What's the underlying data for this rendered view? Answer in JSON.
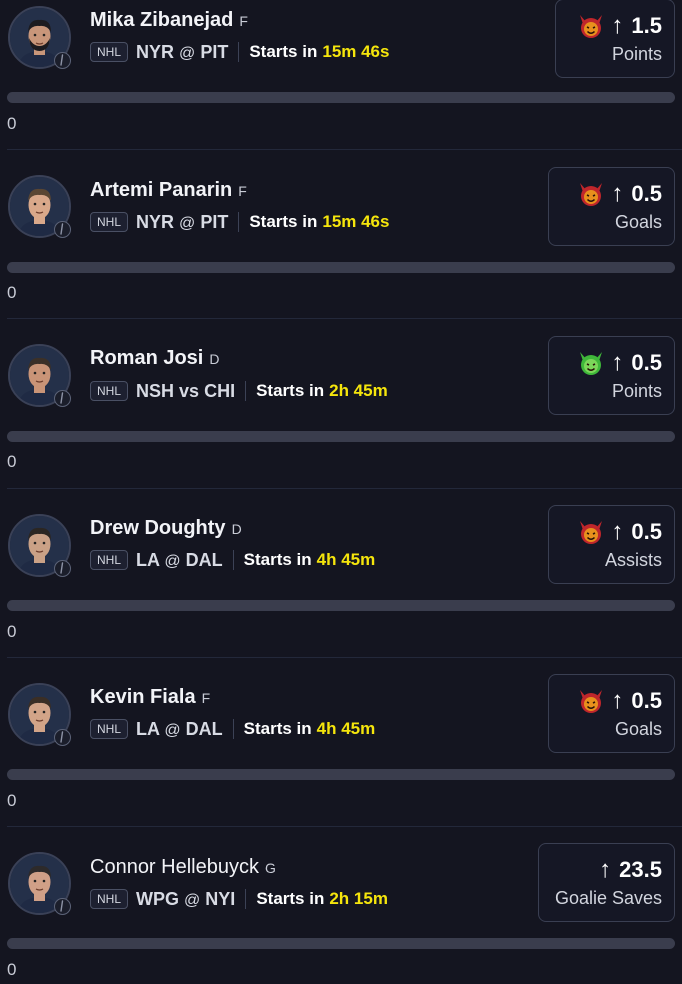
{
  "players": [
    {
      "name": "Mika Zibanejad",
      "position": "F",
      "league": "NHL",
      "team": "NYR",
      "connector": "@",
      "opponent": "PIT",
      "starts_label": "Starts in",
      "time": "15m 46s",
      "pick": {
        "emoji": "red-devil-icon",
        "direction": "↑",
        "value": "1.5",
        "stat": "Points"
      },
      "progress": 0,
      "count": "0"
    },
    {
      "name": "Artemi Panarin",
      "position": "F",
      "league": "NHL",
      "team": "NYR",
      "connector": "@",
      "opponent": "PIT",
      "starts_label": "Starts in",
      "time": "15m 46s",
      "pick": {
        "emoji": "red-devil-icon",
        "direction": "↑",
        "value": "0.5",
        "stat": "Goals"
      },
      "progress": 0,
      "count": "0"
    },
    {
      "name": "Roman Josi",
      "position": "D",
      "league": "NHL",
      "team": "NSH",
      "connector": "vs",
      "opponent": "CHI",
      "starts_label": "Starts in",
      "time": "2h 45m",
      "pick": {
        "emoji": "green-devil-icon",
        "direction": "↑",
        "value": "0.5",
        "stat": "Points"
      },
      "progress": 0,
      "count": "0"
    },
    {
      "name": "Drew Doughty",
      "position": "D",
      "league": "NHL",
      "team": "LA",
      "connector": "@",
      "opponent": "DAL",
      "starts_label": "Starts in",
      "time": "4h 45m",
      "pick": {
        "emoji": "red-devil-icon",
        "direction": "↑",
        "value": "0.5",
        "stat": "Assists"
      },
      "progress": 0,
      "count": "0"
    },
    {
      "name": "Kevin Fiala",
      "position": "F",
      "league": "NHL",
      "team": "LA",
      "connector": "@",
      "opponent": "DAL",
      "starts_label": "Starts in",
      "time": "4h 45m",
      "pick": {
        "emoji": "red-devil-icon",
        "direction": "↑",
        "value": "0.5",
        "stat": "Goals"
      },
      "progress": 0,
      "count": "0"
    },
    {
      "name": "Connor Hellebuyck",
      "position": "G",
      "league": "NHL",
      "team": "WPG",
      "connector": "@",
      "opponent": "NYI",
      "starts_label": "Starts in",
      "time": "2h 15m",
      "pick": {
        "emoji": "",
        "direction": "↑",
        "value": "23.5",
        "stat": "Goalie Saves"
      },
      "progress": 0,
      "count": "0"
    }
  ],
  "colors": {
    "background": "#141520",
    "highlight": "#f5e50c",
    "red_devil": "#c0262b",
    "green_devil": "#3fb83a",
    "bar": "#3a3d4d"
  }
}
